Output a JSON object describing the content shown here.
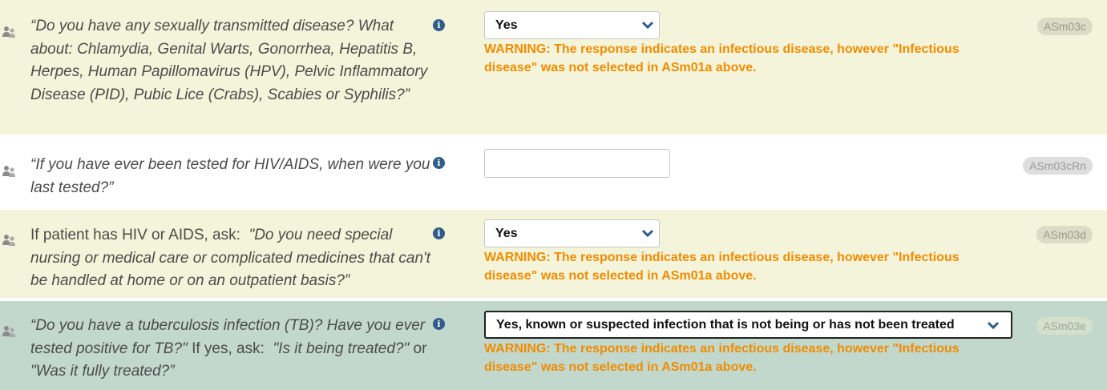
{
  "questions": [
    {
      "id": "ASm03c",
      "prefix": "",
      "parts": [
        "“Do you have any sexually transmitted disease? What about: Chlamydia, Genital Warts, Gonorrhea, Hepatitis B, Herpes, Human Papillomavirus (HPV), Pelvic Inflammatory Disease (PID), Pubic Lice (Crabs), Scabies or Syphilis?”"
      ],
      "answer": "Yes",
      "warning": "WARNING: The response indicates an infectious disease, however \"Infectious disease\" was not selected in ASm01a above."
    },
    {
      "id": "ASm03cRn",
      "prefix": "",
      "parts": [
        "“If you have ever been tested for HIV/AIDS, when were you last tested?”"
      ],
      "answer": ""
    },
    {
      "id": "ASm03d",
      "prefix": "If patient has HIV or AIDS, ask:",
      "parts": [
        "\"Do you need special nursing or medical care or complicated medicines that can't be handled at home or on an outpatient basis?”"
      ],
      "answer": "Yes",
      "warning": "WARNING: The response indicates an infectious disease, however \"Infectious disease\" was not selected in ASm01a above."
    },
    {
      "id": "ASm03e",
      "prefix": "",
      "q_part1": "“Do you have a tuberculosis infection (TB)? Have you ever tested positive for TB?\"",
      "q_mid1": "If yes, ask:",
      "q_part2": "\"Is it being treated?\"",
      "q_mid2": "or",
      "q_part3": "\"Was it fully treated?”",
      "answer": "Yes, known or suspected infection that is not being or has not been treated",
      "warning": "WARNING: The response indicates an infectious disease, however \"Infectious disease\" was not selected in ASm01a above."
    }
  ],
  "colors": {
    "highlight_row": "#f4f4da",
    "active_row": "#c2d8cc",
    "warning": "#f08c00",
    "info_icon": "#2f5c88"
  },
  "icons": {
    "person": "people-icon",
    "info": "info-icon",
    "dropdown": "chevron-down-icon"
  }
}
